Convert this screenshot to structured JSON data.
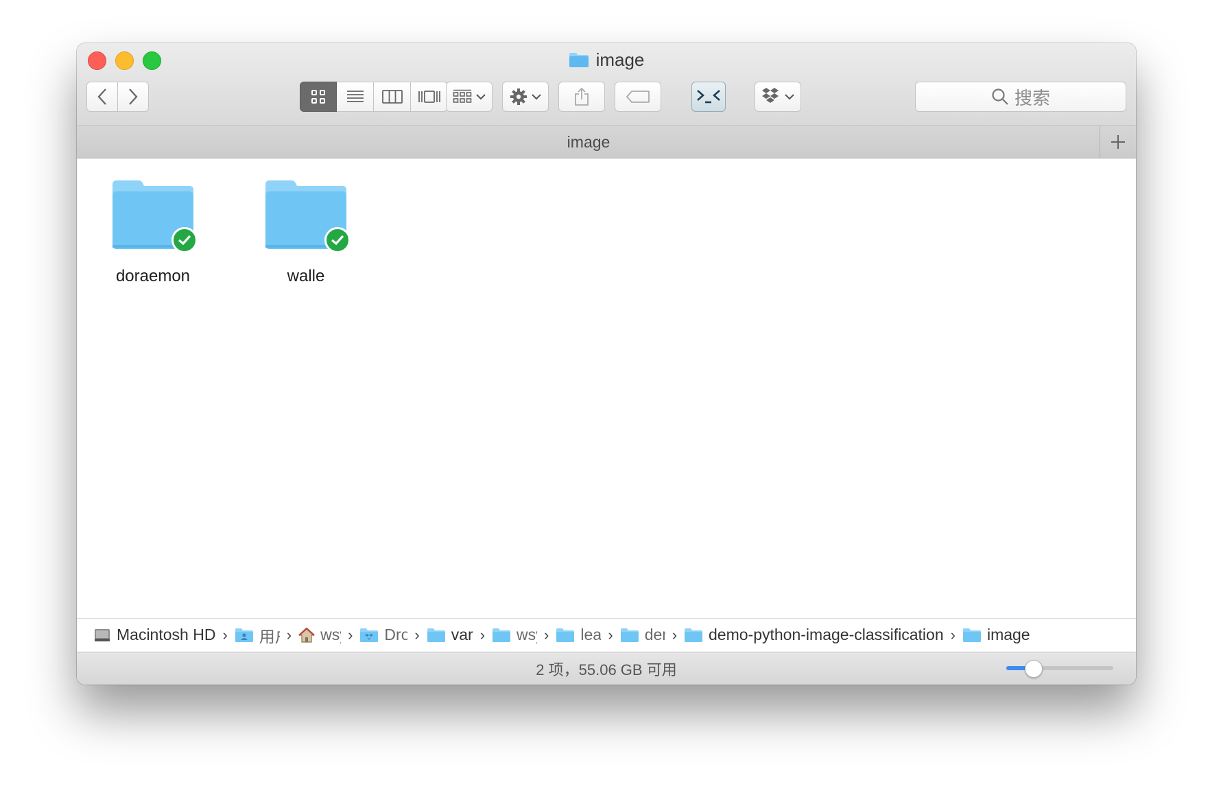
{
  "window": {
    "title": "image"
  },
  "tab": {
    "title": "image"
  },
  "search": {
    "placeholder": "搜索"
  },
  "items": [
    {
      "name": "doraemon",
      "synced": true
    },
    {
      "name": "walle",
      "synced": true
    }
  ],
  "pathbar": {
    "crumbs": [
      {
        "label": "Macintosh HD",
        "icon": "hard-drive-icon"
      },
      {
        "label": "用户",
        "icon": "users-folder-icon",
        "truncated": true
      },
      {
        "label": "wsy",
        "icon": "home-icon",
        "truncated": true
      },
      {
        "label": "Dropbox",
        "icon": "dropbox-folder-icon",
        "truncated": true
      },
      {
        "label": "var",
        "icon": "folder-icon"
      },
      {
        "label": "wsy",
        "icon": "folder-icon",
        "truncated": true
      },
      {
        "label": "learn",
        "icon": "folder-icon",
        "truncated": true
      },
      {
        "label": "demo",
        "icon": "folder-icon",
        "truncated": true
      },
      {
        "label": "demo-python-image-classification",
        "icon": "folder-icon"
      },
      {
        "label": "image",
        "icon": "folder-icon"
      }
    ]
  },
  "status": {
    "text": "2 项，55.06 GB 可用"
  },
  "zoom": {
    "value": 0.25
  },
  "colors": {
    "folder": "#6fc6f5",
    "folder_tab": "#8fd3f8",
    "sync_badge": "#23a843",
    "slider_fill": "#3b8cf2"
  }
}
